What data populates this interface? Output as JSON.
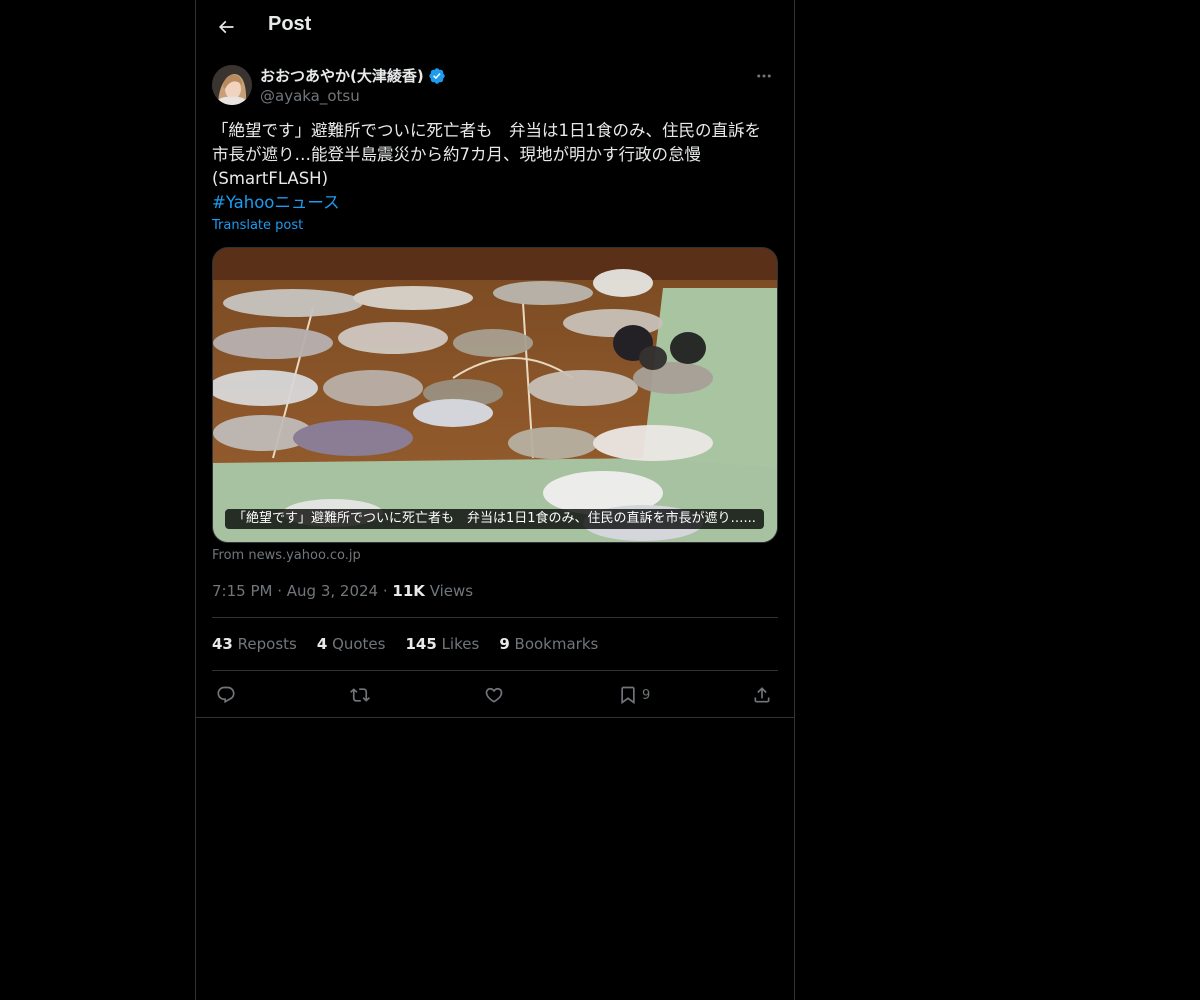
{
  "header": {
    "title": "Post"
  },
  "author": {
    "name": "おおつあやか(大津綾香)",
    "handle": "@ayaka_otsu",
    "verified": true,
    "verified_color": "#1d9bf0"
  },
  "post": {
    "lines": [
      "「絶望です」避難所でついに死亡者も　弁当は1日1食のみ、住民の直訴を",
      "市長が遮り…能登半島震災から約7カ月、現地が明かす行政の怠慢",
      "(SmartFLASH)"
    ],
    "hashtag": "#Yahooニュース",
    "translate_label": "Translate post"
  },
  "card": {
    "caption": "「絶望です」避難所でついに死亡者も　弁当は1日1食のみ、住民の直訴を市長が遮り…...",
    "source": "From news.yahoo.co.jp"
  },
  "meta": {
    "time": "7:15 PM",
    "date": "Aug 3, 2024",
    "views_count": "11K",
    "views_label": "Views"
  },
  "stats": {
    "reposts_count": "43",
    "reposts_label": "Reposts",
    "quotes_count": "4",
    "quotes_label": "Quotes",
    "likes_count": "145",
    "likes_label": "Likes",
    "bookmarks_count": "9",
    "bookmarks_label": "Bookmarks"
  },
  "actions": {
    "reply_icon": "reply-icon",
    "repost_icon": "repost-icon",
    "like_icon": "heart-icon",
    "bookmark_icon": "bookmark-icon",
    "bookmark_count": "9",
    "share_icon": "share-icon"
  },
  "colors": {
    "background": "#000000",
    "text": "#e7e9ea",
    "muted": "#71767b",
    "accent": "#1d9bf0",
    "border": "#2f3336"
  }
}
